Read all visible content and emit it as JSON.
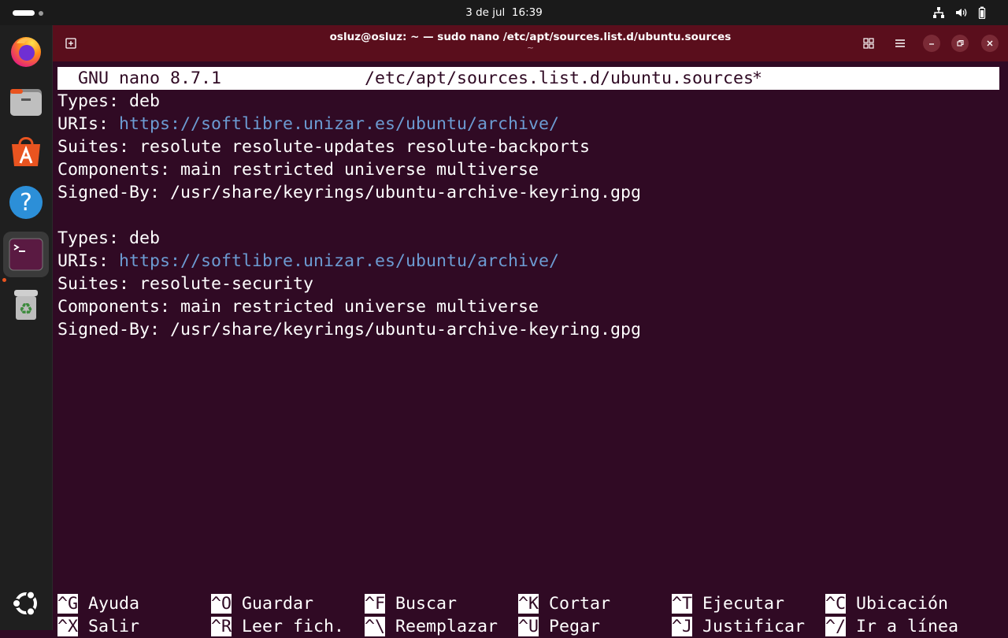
{
  "topbar": {
    "date": "3 de jul",
    "time": "16:39"
  },
  "dock": {
    "apps": [
      "firefox-icon",
      "files-icon",
      "app-center-icon",
      "help-icon",
      "terminal-icon",
      "trash-icon"
    ],
    "show_apps": "ubuntu-logo-icon"
  },
  "window": {
    "title": "osluz@osluz: ~ — sudo nano /etc/apt/sources.list.d/ubuntu.sources",
    "title_sub": "~"
  },
  "nano": {
    "version": "GNU nano 8.7.1",
    "filename": "/etc/apt/sources.list.d/ubuntu.sources",
    "modified": "*",
    "lines": [
      {
        "label": "Types: ",
        "value": "deb"
      },
      {
        "label": "URIs: ",
        "value": "https://softlibre.unizar.es/ubuntu/archive/"
      },
      {
        "label": "Suites: ",
        "value": "resolute resolute-updates resolute-backports"
      },
      {
        "label": "Components: ",
        "value": "main restricted universe multiverse"
      },
      {
        "label": "Signed-By: ",
        "value": "/usr/share/keyrings/ubuntu-archive-keyring.gpg"
      },
      {
        "label": "",
        "value": ""
      },
      {
        "label": "Types: ",
        "value": "deb"
      },
      {
        "label": "URIs: ",
        "value": "https://softlibre.unizar.es/ubuntu/archive/"
      },
      {
        "label": "Suites: ",
        "value": "resolute-security"
      },
      {
        "label": "Components: ",
        "value": "main restricted universe multiverse"
      },
      {
        "label": "Signed-By: ",
        "value": "/usr/share/keyrings/ubuntu-archive-keyring.gpg"
      }
    ],
    "shortcuts": [
      [
        {
          "key": "^G",
          "label": "Ayuda"
        },
        {
          "key": "^O",
          "label": "Guardar"
        },
        {
          "key": "^F",
          "label": "Buscar"
        },
        {
          "key": "^K",
          "label": "Cortar"
        },
        {
          "key": "^T",
          "label": "Ejecutar"
        },
        {
          "key": "^C",
          "label": "Ubicación"
        }
      ],
      [
        {
          "key": "^X",
          "label": "Salir"
        },
        {
          "key": "^R",
          "label": "Leer fich."
        },
        {
          "key": "^\\",
          "label": "Reemplazar"
        },
        {
          "key": "^U",
          "label": "Pegar"
        },
        {
          "key": "^J",
          "label": "Justificar"
        },
        {
          "key": "^/",
          "label": "Ir a línea"
        }
      ]
    ]
  },
  "colors": {
    "terminal_bg": "#300a24",
    "titlebar_bg": "#5a0e1c",
    "url": "#6c9bd2",
    "accent": "#e95420"
  }
}
